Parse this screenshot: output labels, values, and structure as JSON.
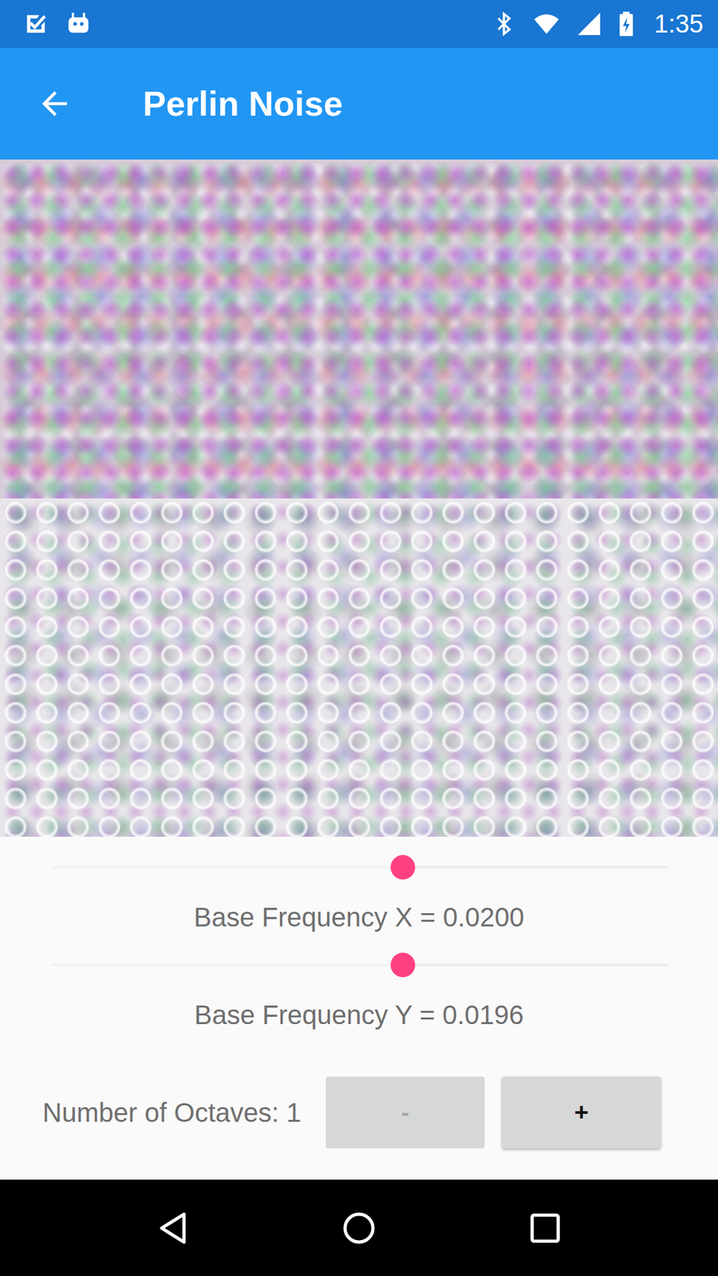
{
  "status_bar": {
    "time": "1:35"
  },
  "app_bar": {
    "title": "Perlin Noise"
  },
  "sliders": [
    {
      "label": "Base Frequency X = 0.0200",
      "level": 0.57
    },
    {
      "label": "Base Frequency Y = 0.0196",
      "level": 0.57
    }
  ],
  "octaves": {
    "label": "Number of Octaves: 1",
    "buttons": [
      {
        "label": "-",
        "disabled": true
      },
      {
        "label": "+",
        "disabled": false
      }
    ]
  }
}
